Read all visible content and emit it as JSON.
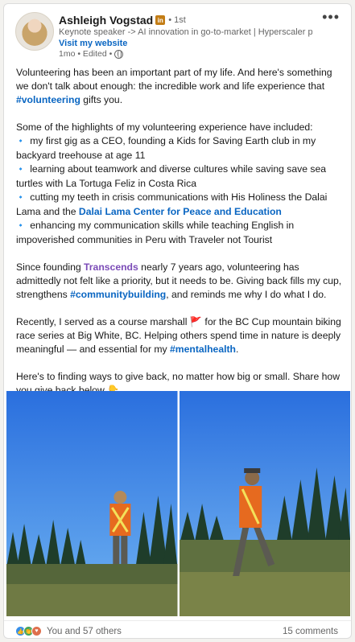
{
  "author": {
    "name": "Ashleigh Vogstad",
    "badge": "in",
    "degree": "• 1st",
    "headline": "Keynote speaker -> AI innovation in go-to-market | Hyperscaler part...",
    "website_link": "Visit my website",
    "meta": "1mo • Edited •"
  },
  "post": {
    "p1": "Volunteering has been an important part of my life. And here's something we don't talk about enough: the incredible work and life experience that ",
    "p1_tag": "#volunteering",
    "p1_end": " gifts you.",
    "p2_intro": "Some of the highlights of my volunteering experience have included:",
    "b1": "my first gig as a CEO, founding a Kids for Saving Earth club in my backyard treehouse at age 11",
    "b2": "learning about teamwork and diverse cultures while saving save sea turtles with La Tortuga Feliz in Costa Rica",
    "b3_start": "cutting my teeth in crisis communications with His Holiness the Dalai Lama and the ",
    "b3_link": "Dalai Lama Center for Peace and Education",
    "b4": "enhancing my communication skills while teaching English in impoverished communities in Peru with Traveler not Tourist",
    "p3_start": "Since founding ",
    "p3_company": "Transcends",
    "p3_mid": " nearly 7 years ago, volunteering has admittedly not felt like a priority, but it needs to be. Giving back fills my cup, strengthens ",
    "p3_tag": "#communitybuilding",
    "p3_end": ", and reminds me why I do what I do.",
    "p4_start": "Recently, I served as a course marshall ",
    "p4_flag": "🚩",
    "p4_mid": " for the BC Cup mountain biking race series at Big White, BC. Helping others spend time in nature is deeply meaningful — and essential for my ",
    "p4_tag": "#mentalhealth",
    "p4_end": ".",
    "p5": "Here's to finding ways to give back, no matter how big or small. Share how you give back below ",
    "p5_emoji": "👇",
    "bullet_glyph": "🔹"
  },
  "footer": {
    "reactions_text": "You and 57 others",
    "comments_text": "15 comments"
  },
  "icons": {
    "more": "more-options-icon",
    "globe": "globe-icon",
    "like": "like-reaction-icon",
    "celebrate": "celebrate-reaction-icon",
    "love": "love-reaction-icon"
  },
  "colors": {
    "link_blue": "#0a66c2",
    "company_purple": "#7b4bb7",
    "muted": "#666666",
    "sky": "#2f7fe6"
  }
}
